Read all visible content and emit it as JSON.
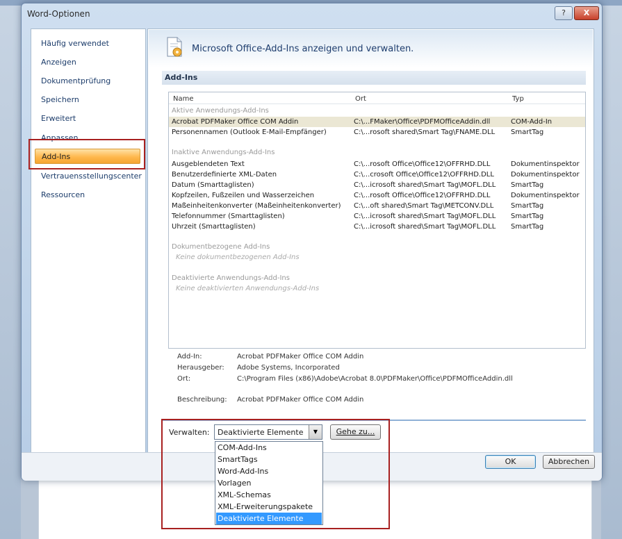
{
  "window": {
    "title": "Word-Optionen",
    "help_label": "?",
    "close_label": "X"
  },
  "nav": {
    "items": [
      {
        "label": "Häufig verwendet"
      },
      {
        "label": "Anzeigen"
      },
      {
        "label": "Dokumentprüfung"
      },
      {
        "label": "Speichern"
      },
      {
        "label": "Erweitert"
      },
      {
        "label": "Anpassen"
      },
      {
        "label": "Add-Ins",
        "active": true
      },
      {
        "label": "Vertrauensstellungscenter"
      },
      {
        "label": "Ressourcen"
      }
    ]
  },
  "main": {
    "title": "Microsoft Office-Add-Ins anzeigen und verwalten.",
    "section_label": "Add-Ins",
    "columns": {
      "name": "Name",
      "location": "Ort",
      "type": "Typ"
    },
    "groups": {
      "active": "Aktive Anwendungs-Add-Ins",
      "inactive": "Inaktive Anwendungs-Add-Ins",
      "document": "Dokumentbezogene Add-Ins",
      "document_empty": "Keine dokumentbezogenen Add-Ins",
      "disabled": "Deaktivierte Anwendungs-Add-Ins",
      "disabled_empty": "Keine deaktivierten Anwendungs-Add-Ins"
    },
    "active_rows": [
      {
        "name": "Acrobat PDFMaker Office COM Addin",
        "location": "C:\\...FMaker\\Office\\PDFMOfficeAddin.dll",
        "type": "COM-Add-In",
        "selected": true
      },
      {
        "name": "Personennamen (Outlook E-Mail-Empfänger)",
        "location": "C:\\...rosoft shared\\Smart Tag\\FNAME.DLL",
        "type": "SmartTag"
      }
    ],
    "inactive_rows": [
      {
        "name": "Ausgeblendeten Text",
        "location": "C:\\...rosoft Office\\Office12\\OFFRHD.DLL",
        "type": "Dokumentinspektor"
      },
      {
        "name": "Benutzerdefinierte XML-Daten",
        "location": "C:\\...crosoft Office\\Office12\\OFFRHD.DLL",
        "type": "Dokumentinspektor"
      },
      {
        "name": "Datum (Smarttaglisten)",
        "location": "C:\\...icrosoft shared\\Smart Tag\\MOFL.DLL",
        "type": "SmartTag"
      },
      {
        "name": "Kopfzeilen, Fußzeilen und Wasserzeichen",
        "location": "C:\\...rosoft Office\\Office12\\OFFRHD.DLL",
        "type": "Dokumentinspektor"
      },
      {
        "name": "Maßeinheitenkonverter (Maßeinheitenkonverter)",
        "location": "C:\\...oft shared\\Smart Tag\\METCONV.DLL",
        "type": "SmartTag"
      },
      {
        "name": "Telefonnummer (Smarttaglisten)",
        "location": "C:\\...icrosoft shared\\Smart Tag\\MOFL.DLL",
        "type": "SmartTag"
      },
      {
        "name": "Uhrzeit (Smarttaglisten)",
        "location": "C:\\...icrosoft shared\\Smart Tag\\MOFL.DLL",
        "type": "SmartTag"
      }
    ],
    "details": {
      "addin_label": "Add-In:",
      "addin_value": "Acrobat PDFMaker Office COM Addin",
      "publisher_label": "Herausgeber:",
      "publisher_value": "Adobe Systems, Incorporated",
      "location_label": "Ort:",
      "location_value": "C:\\Program Files (x86)\\Adobe\\Acrobat 8.0\\PDFMaker\\Office\\PDFMOfficeAddin.dll",
      "description_label": "Beschreibung:",
      "description_value": "Acrobat PDFMaker Office COM Addin"
    }
  },
  "manage": {
    "label": "Verwalten:",
    "selected": "Deaktivierte Elemente",
    "goto_label": "Gehe zu...",
    "options": [
      "COM-Add-Ins",
      "SmartTags",
      "Word-Add-Ins",
      "Vorlagen",
      "XML-Schemas",
      "XML-Erweiterungspakete",
      "Deaktivierte Elemente"
    ]
  },
  "buttons": {
    "ok": "OK",
    "cancel": "Abbrechen"
  },
  "colors": {
    "accent": "#ffb84d",
    "highlight_box": "#a82020",
    "dropdown_selected": "#3399ff"
  }
}
